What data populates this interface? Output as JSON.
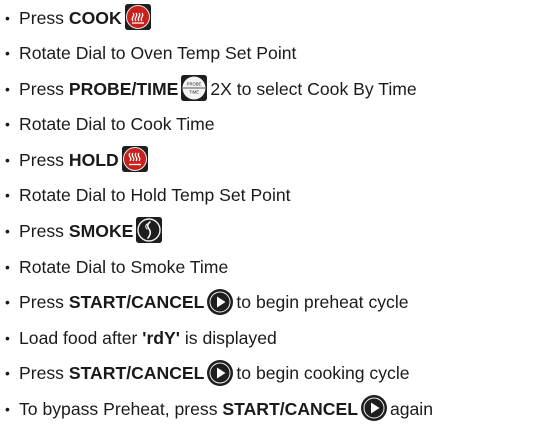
{
  "steps": [
    {
      "pre": "Press ",
      "bold": "COOK",
      "icon": "cook-icon",
      "post": ""
    },
    {
      "pre": "Rotate Dial to Oven Temp Set Point",
      "bold": "",
      "icon": "",
      "post": ""
    },
    {
      "pre": "Press ",
      "bold": "PROBE/TIME",
      "icon": "probe-time-icon",
      "post": "2X to select Cook By Time"
    },
    {
      "pre": "Rotate Dial to Cook Time",
      "bold": "",
      "icon": "",
      "post": ""
    },
    {
      "pre": "Press ",
      "bold": "HOLD",
      "icon": "hold-icon",
      "post": ""
    },
    {
      "pre": "Rotate Dial to Hold Temp Set Point",
      "bold": "",
      "icon": "",
      "post": ""
    },
    {
      "pre": "Press ",
      "bold": "SMOKE",
      "icon": "smoke-icon",
      "post": ""
    },
    {
      "pre": "Rotate Dial to Smoke Time",
      "bold": "",
      "icon": "",
      "post": ""
    },
    {
      "pre": "Press ",
      "bold": "START/CANCEL",
      "icon": "play-icon",
      "post": "to begin preheat cycle"
    },
    {
      "pre": "Load food after ",
      "bold": "'rdY'",
      "icon": "",
      "post": " is displayed"
    },
    {
      "pre": "Press ",
      "bold": "START/CANCEL",
      "icon": "play-icon",
      "post": "to begin cooking cycle"
    },
    {
      "pre": "To bypass Preheat, press ",
      "bold": "START/CANCEL",
      "icon": "play-icon",
      "post": "again"
    }
  ],
  "icons": {
    "probe_top": "PROBE",
    "probe_bottom": "TIME"
  },
  "colors": {
    "cook_red": "#c8211b",
    "icon_dark": "#1e1e1e",
    "text": "#1a1a1a"
  }
}
